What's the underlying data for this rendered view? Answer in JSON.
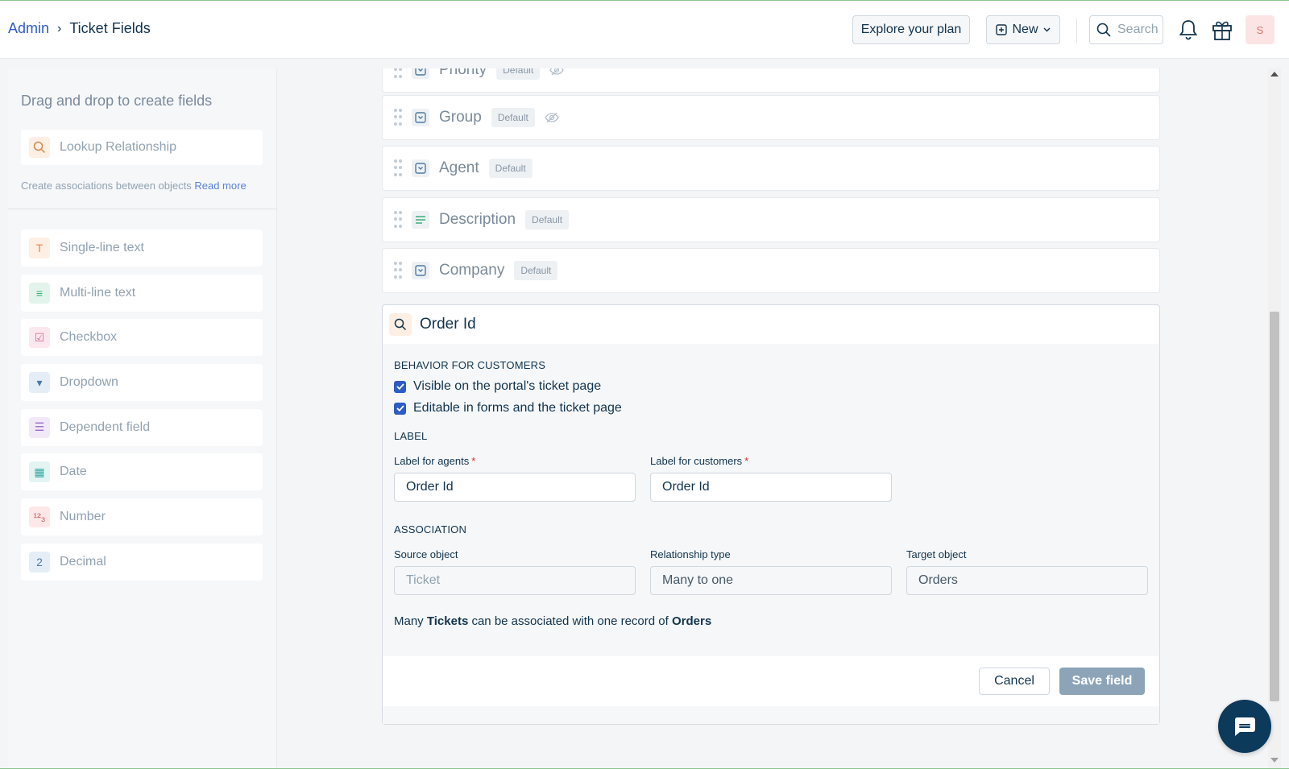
{
  "breadcrumb": {
    "parent": "Admin",
    "current": "Ticket Fields"
  },
  "header": {
    "explore": "Explore your plan",
    "new": "New",
    "search_placeholder": "Search",
    "avatar": "S"
  },
  "left": {
    "title": "Drag and drop to create fields",
    "lookup": "Lookup Relationship",
    "lookup_desc": "Create associations between objects",
    "read_more": "Read more",
    "items": [
      {
        "label": "Single-line text",
        "icon": "text-icon",
        "glyph": "T",
        "color": "#fdefe3",
        "fg": "#e08a4f"
      },
      {
        "label": "Multi-line text",
        "icon": "paragraph-icon",
        "glyph": "≡",
        "color": "#e3f4ec",
        "fg": "#3cae7a"
      },
      {
        "label": "Checkbox",
        "icon": "checkbox-icon",
        "glyph": "☑",
        "color": "#fde7ee",
        "fg": "#d06a8e"
      },
      {
        "label": "Dropdown",
        "icon": "dropdown-icon",
        "glyph": "▾",
        "color": "#e5eef7",
        "fg": "#4e7aa3"
      },
      {
        "label": "Dependent field",
        "icon": "list-icon",
        "glyph": "☰",
        "color": "#f1e9f7",
        "fg": "#9a69c3"
      },
      {
        "label": "Date",
        "icon": "calendar-icon",
        "glyph": "▦",
        "color": "#e3f4f3",
        "fg": "#3ba8a2"
      },
      {
        "label": "Number",
        "icon": "number-icon",
        "glyph": "¹²₃",
        "color": "#fde7e7",
        "fg": "#c95b5b"
      },
      {
        "label": "Decimal",
        "icon": "decimal-icon",
        "glyph": "2",
        "color": "#e5eef7",
        "fg": "#4e7aa3"
      }
    ]
  },
  "fields": [
    {
      "name": "Priority",
      "badge": "Default",
      "hidden": true
    },
    {
      "name": "Group",
      "badge": "Default",
      "hidden": true
    },
    {
      "name": "Agent",
      "badge": "Default",
      "hidden": false
    },
    {
      "name": "Description",
      "badge": "Default",
      "hidden": false
    },
    {
      "name": "Company",
      "badge": "Default",
      "hidden": false
    }
  ],
  "editor": {
    "title": "Order Id",
    "behavior_heading": "BEHAVIOR FOR CUSTOMERS",
    "visible_label": "Visible on the portal's ticket page",
    "editable_label": "Editable in forms and the ticket page",
    "label_heading": "LABEL",
    "agents_label": "Label for agents",
    "agents_value": "Order Id",
    "customers_label": "Label for customers",
    "customers_value": "Order Id",
    "association_heading": "ASSOCIATION",
    "source_label": "Source object",
    "source_value": "Ticket",
    "rel_label": "Relationship type",
    "rel_value": "Many to one",
    "target_label": "Target object",
    "target_value": "Orders",
    "desc_1": "Many",
    "desc_tickets": "Tickets",
    "desc_2": "can be associated with one record of",
    "desc_orders": "Orders",
    "cancel": "Cancel",
    "save": "Save field"
  },
  "colors": {
    "accent": "#2c5cc5",
    "save_disabled": "#8da4b8",
    "chat": "#0b3a5b"
  }
}
